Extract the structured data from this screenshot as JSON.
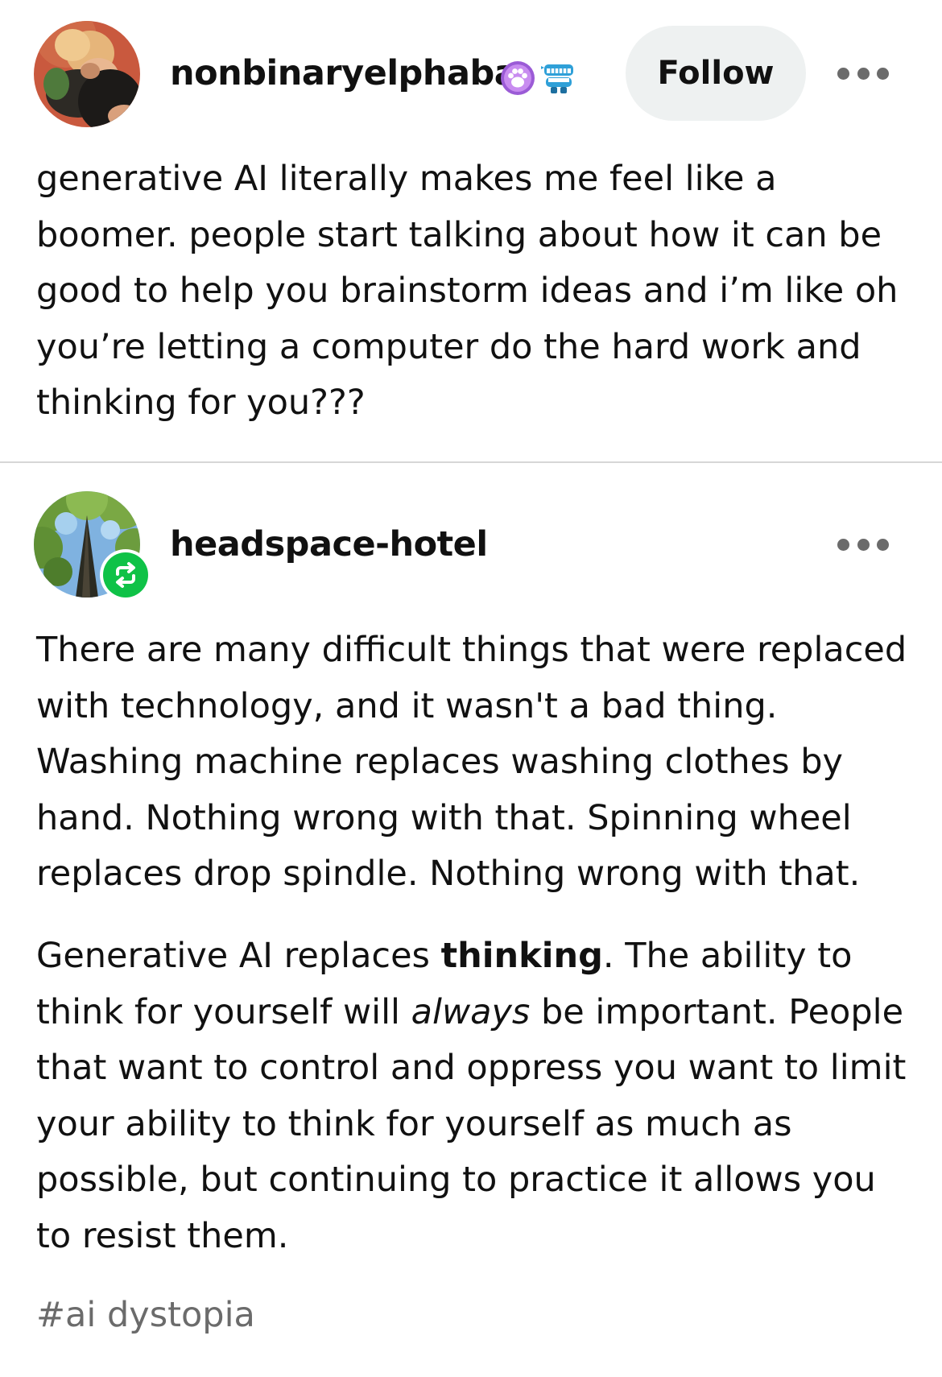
{
  "original_post": {
    "username": "nonbinaryelphaba",
    "follow_label": "Follow",
    "badges": [
      "paw-badge-icon",
      "chattering-teeth-badge-icon"
    ],
    "body": "generative AI literally makes me feel like a boomer. people start talking about how it can be good to help you brainstorm ideas and i’m like oh you’re letting a computer do the hard work and thinking for you???"
  },
  "reblog": {
    "username": "headspace-hotel",
    "paragraph1": "There are many difficult things that were replaced with technology, and it wasn't a bad thing. Washing machine replaces washing clothes by hand. Nothing wrong with that. Spinning wheel replaces drop spindle. Nothing wrong with that.",
    "paragraph2": {
      "before_bold": "Generative AI replaces ",
      "bold": "thinking",
      "mid": ". The ability to think for yourself will ",
      "italic": "always",
      "after": " be important. People that want to control and oppress you want to limit your ability to think for yourself as much as possible, but continuing to practice it allows you to resist them."
    },
    "tag": "#ai dystopia"
  },
  "colors": {
    "text": "#111111",
    "muted": "#6b6b6b",
    "follow_bg": "#eef1f1",
    "reblog_green": "#0fc247",
    "divider": "#d6d6d6"
  }
}
